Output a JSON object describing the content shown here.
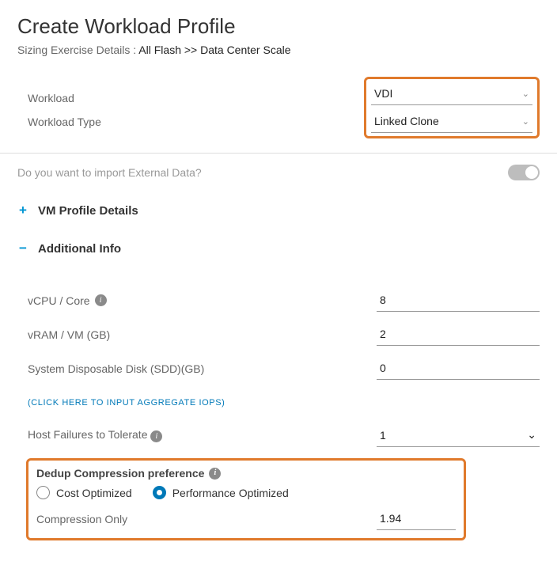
{
  "title": "Create Workload Profile",
  "breadcrumb": {
    "prefix": "Sizing Exercise Details : ",
    "path": "All Flash >> Data Center Scale"
  },
  "workload": {
    "label": "Workload",
    "value": "VDI",
    "type_label": "Workload Type",
    "type_value": "Linked Clone"
  },
  "import": {
    "label": "Do you want to import External Data?",
    "enabled": false
  },
  "sections": {
    "vm_profile": {
      "title": "VM Profile Details",
      "expanded": false
    },
    "additional": {
      "title": "Additional Info",
      "expanded": true
    }
  },
  "additional": {
    "vcpu_label": "vCPU / Core",
    "vcpu_value": "8",
    "vram_label": "vRAM / VM (GB)",
    "vram_value": "2",
    "sdd_label": "System Disposable Disk (SDD)(GB)",
    "sdd_value": "0",
    "iops_link": "(CLICK HERE TO INPUT AGGREGATE IOPS)",
    "hft_label": "Host Failures to Tolerate",
    "hft_value": "1"
  },
  "dedup": {
    "title": "Dedup Compression preference",
    "cost_label": "Cost Optimized",
    "perf_label": "Performance Optimized",
    "selected": "perf",
    "compression_label": "Compression Only",
    "compression_value": "1.94"
  }
}
